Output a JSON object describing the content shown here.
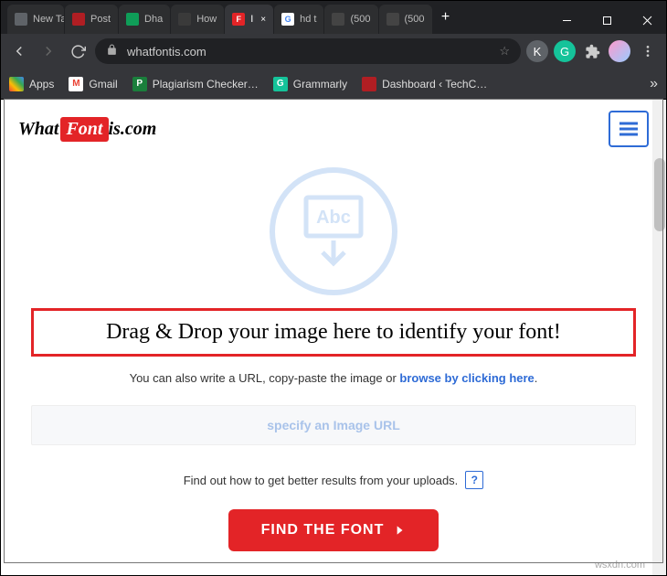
{
  "window": {
    "tabs": [
      {
        "label": "New Tab",
        "fav_bg": "#5f6368",
        "fav_text": ""
      },
      {
        "label": "Post",
        "fav_bg": "#b01e23",
        "fav_text": ""
      },
      {
        "label": "Dha",
        "fav_bg": "#0f9d58",
        "fav_text": ""
      },
      {
        "label": "How",
        "fav_bg": "#3a3a3a",
        "fav_text": ""
      },
      {
        "label": "I",
        "fav_bg": "#e32427",
        "fav_text": "F",
        "active": true
      },
      {
        "label": "hd t",
        "fav_bg": "#fff",
        "fav_text": "G"
      },
      {
        "label": "(500",
        "fav_bg": "#444",
        "fav_text": ""
      },
      {
        "label": "(500",
        "fav_bg": "#444",
        "fav_text": ""
      }
    ]
  },
  "address": {
    "url": "whatfontis.com"
  },
  "bookmarks": [
    {
      "label": "Apps",
      "bg": "#4285f4",
      "text": ""
    },
    {
      "label": "Gmail",
      "bg": "#fff",
      "text": "M"
    },
    {
      "label": "Plagiarism Checker…",
      "bg": "#1a7f3c",
      "text": "P"
    },
    {
      "label": "Grammarly",
      "bg": "#15c39a",
      "text": "G"
    },
    {
      "label": "Dashboard ‹ TechC…",
      "bg": "#b01e23",
      "text": ""
    }
  ],
  "site": {
    "logo_what": "What",
    "logo_font": "Font",
    "logo_iscom": "is.com",
    "watermark_abc": "Abc",
    "headline": "Drag & Drop your image here to identify your font!",
    "sub_pre": "You can also write a URL, copy-paste the image or ",
    "sub_link": "browse by clicking here",
    "sub_post": ".",
    "url_placeholder": "specify an Image URL",
    "help_text": "Find out how to get better results from your uploads.",
    "help_q": "?",
    "cta": "FIND THE FONT"
  },
  "footer_mark": "wsxdn.com"
}
